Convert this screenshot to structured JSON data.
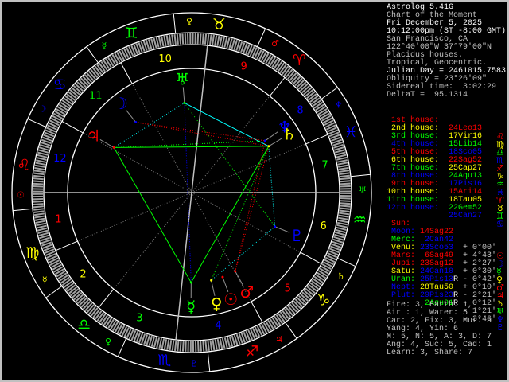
{
  "header": {
    "app_title": "Astrolog 5.41G",
    "chart_name": "Chart of the Moment",
    "date": "Fri December 5, 2025",
    "time": "10:12:00pm (ST -8:00 GMT)",
    "location": "San Francisco, CA",
    "coordinates": "122°40'00\"W 37°79'00\"N",
    "house_system": "Placidus houses.",
    "zodiac": "Tropical, Geocentric.",
    "julian_day": "Julian Day = 2461015.7583",
    "obliquity": "Obliquity = 23°26'09\"",
    "sidereal_time": "Sidereal time:  3:02:29",
    "delta_t": "DeltaT =  95.1314"
  },
  "colors": {
    "fire": "#ff0000",
    "earth": "#ffff00",
    "air": "#00ff00",
    "water": "#0000ff",
    "text": "#ffffff",
    "dim": "#c0c0c0",
    "cyan": "#00ffff"
  },
  "signs": [
    {
      "name": "Aries",
      "glyph": "♈",
      "element": "fire",
      "ruler": "♂"
    },
    {
      "name": "Taurus",
      "glyph": "♉",
      "element": "earth",
      "ruler": "♀"
    },
    {
      "name": "Gemini",
      "glyph": "♊",
      "element": "air",
      "ruler": "☿"
    },
    {
      "name": "Cancer",
      "glyph": "♋",
      "element": "water",
      "ruler": "☽"
    },
    {
      "name": "Leo",
      "glyph": "♌",
      "element": "fire",
      "ruler": "☉"
    },
    {
      "name": "Virgo",
      "glyph": "♍",
      "element": "earth",
      "ruler": "☿"
    },
    {
      "name": "Libra",
      "glyph": "♎",
      "element": "air",
      "ruler": "♀"
    },
    {
      "name": "Scorpio",
      "glyph": "♏",
      "element": "water",
      "ruler": "♇"
    },
    {
      "name": "Sagittarius",
      "glyph": "♐",
      "element": "fire",
      "ruler": "♃"
    },
    {
      "name": "Capricorn",
      "glyph": "♑",
      "element": "earth",
      "ruler": "♄"
    },
    {
      "name": "Aquarius",
      "glyph": "♒",
      "element": "air",
      "ruler": "♅"
    },
    {
      "name": "Pisces",
      "glyph": "♓",
      "element": "water",
      "ruler": "♆"
    }
  ],
  "houses": [
    {
      "label": "1st house:",
      "number": "1",
      "cusp": "24Leo13",
      "color": "#ff0000",
      "glyph": "♌"
    },
    {
      "label": "2nd house:",
      "number": "2",
      "cusp": "17Vir16",
      "color": "#ffff00",
      "glyph": "♍"
    },
    {
      "label": "3rd house:",
      "number": "3",
      "cusp": "15Lib14",
      "color": "#00ff00",
      "glyph": "♎"
    },
    {
      "label": "4th house:",
      "number": "4",
      "cusp": "18Sco05",
      "color": "#0000ff",
      "glyph": "♏"
    },
    {
      "label": "5th house:",
      "number": "5",
      "cusp": "22Sag52",
      "color": "#ff0000",
      "glyph": "♐"
    },
    {
      "label": "6th house:",
      "number": "6",
      "cusp": "25Cap27",
      "color": "#ffff00",
      "glyph": "♑"
    },
    {
      "label": "7th house:",
      "number": "7",
      "cusp": "24Aqu13",
      "color": "#00ff00",
      "glyph": "♒"
    },
    {
      "label": "8th house:",
      "number": "8",
      "cusp": "17Pis16",
      "color": "#0000ff",
      "glyph": "♓"
    },
    {
      "label": "9th house:",
      "number": "9",
      "cusp": "15Ari14",
      "color": "#ff0000",
      "glyph": "♈"
    },
    {
      "label": "10th house:",
      "number": "10",
      "cusp": "18Tau05",
      "color": "#ffff00",
      "glyph": "♉"
    },
    {
      "label": "11th house:",
      "number": "11",
      "cusp": "22Gem52",
      "color": "#00ff00",
      "glyph": "♊"
    },
    {
      "label": "12th house:",
      "number": "12",
      "cusp": "25Can27",
      "color": "#0000ff",
      "glyph": "♋"
    }
  ],
  "planets": [
    {
      "label": "Sun:",
      "name": "Sun",
      "position": "14Sag22",
      "pos_color": "#ff0000",
      "retro": "",
      "lat": "+ 0°00'",
      "color": "#ff0000",
      "glyph": "☉"
    },
    {
      "label": "Moon:",
      "name": "Moon",
      "position": "2Can42",
      "pos_color": "#0000ff",
      "retro": "",
      "lat": "+ 4°43'",
      "color": "#0000ff",
      "glyph": "☽"
    },
    {
      "label": "Merc:",
      "name": "Mercury",
      "position": "23Sco53",
      "pos_color": "#0000ff",
      "retro": "",
      "lat": "+ 2°27'",
      "color": "#00ff00",
      "glyph": "☿"
    },
    {
      "label": "Venu:",
      "name": "Venus",
      "position": "6Sag49",
      "pos_color": "#ff0000",
      "retro": "",
      "lat": "+ 0°30'",
      "color": "#ffff00",
      "glyph": "♀"
    },
    {
      "label": "Mars:",
      "name": "Mars",
      "position": "23Sag12",
      "pos_color": "#ff0000",
      "retro": "",
      "lat": "- 0°42'",
      "color": "#ff0000",
      "glyph": "♂"
    },
    {
      "label": "Jupi:",
      "name": "Jupiter",
      "position": "24Can10",
      "pos_color": "#0000ff",
      "retro": "R",
      "lat": "+ 0°10'",
      "color": "#ff0000",
      "glyph": "♃"
    },
    {
      "label": "Satu:",
      "name": "Saturn",
      "position": "25Pis13",
      "pos_color": "#0000ff",
      "retro": "",
      "lat": "- 2°21'",
      "color": "#ffff00",
      "glyph": "♄"
    },
    {
      "label": "Uran:",
      "name": "Uranus",
      "position": "28Tau50",
      "pos_color": "#ffff00",
      "retro": "R",
      "lat": "- 0°12'",
      "color": "#00ff00",
      "glyph": "♅"
    },
    {
      "label": "Nept:",
      "name": "Neptune",
      "position": "29Pis23",
      "pos_color": "#0000ff",
      "retro": "R",
      "lat": "- 1°21'",
      "color": "#0000ff",
      "glyph": "♆"
    },
    {
      "label": "Plut:",
      "name": "Pluto",
      "position": "2Aqu01",
      "pos_color": "#00ff00",
      "retro": "",
      "lat": "- 3°46'",
      "color": "#0000ff",
      "glyph": "♇"
    }
  ],
  "aspects": [
    {
      "a": "Uranus",
      "b": "Saturn",
      "color": "#00ffff",
      "style": "solid"
    },
    {
      "a": "Jupiter",
      "b": "Saturn",
      "color": "#00ff00",
      "style": "solid"
    },
    {
      "a": "Jupiter",
      "b": "Mercury",
      "color": "#00ff00",
      "style": "solid"
    },
    {
      "a": "Mercury",
      "b": "Saturn",
      "color": "#00ff00",
      "style": "solid"
    },
    {
      "a": "Moon",
      "b": "Neptune",
      "color": "#ff0000",
      "style": "dotted"
    },
    {
      "a": "Moon",
      "b": "Saturn",
      "color": "#ff0000",
      "style": "dotted"
    },
    {
      "a": "Uranus",
      "b": "Mercury",
      "color": "#0000ff",
      "style": "dotted"
    },
    {
      "a": "Uranus",
      "b": "Pluto",
      "color": "#00ff00",
      "style": "dotted"
    },
    {
      "a": "Jupiter",
      "b": "Uranus",
      "color": "#00ffff",
      "style": "dotted"
    },
    {
      "a": "Saturn",
      "b": "Pluto",
      "color": "#00ffff",
      "style": "dotted"
    },
    {
      "a": "Pluto",
      "b": "Venus",
      "color": "#00ffff",
      "style": "dotted"
    },
    {
      "a": "Saturn",
      "b": "Mars",
      "color": "#ff0000",
      "style": "dotted"
    },
    {
      "a": "Neptune",
      "b": "Mars",
      "color": "#ff0000",
      "style": "dotted"
    },
    {
      "a": "Jupiter",
      "b": "Neptune",
      "color": "#00ff00",
      "style": "dotted"
    },
    {
      "a": "Saturn",
      "b": "Venus",
      "color": "#00ff00",
      "style": "dotted"
    }
  ],
  "summary": [
    "Fire: 3, Earth: 1,",
    "Air : 1, Water: 5",
    "Car: 2, Fix: 3, Mut: 5",
    "Yang: 4, Yin: 6",
    "M: 5, N: 5, A: 3, D: 7",
    "Ang: 4, Suc: 5, Cad: 1",
    "Learn: 3, Share: 7"
  ]
}
